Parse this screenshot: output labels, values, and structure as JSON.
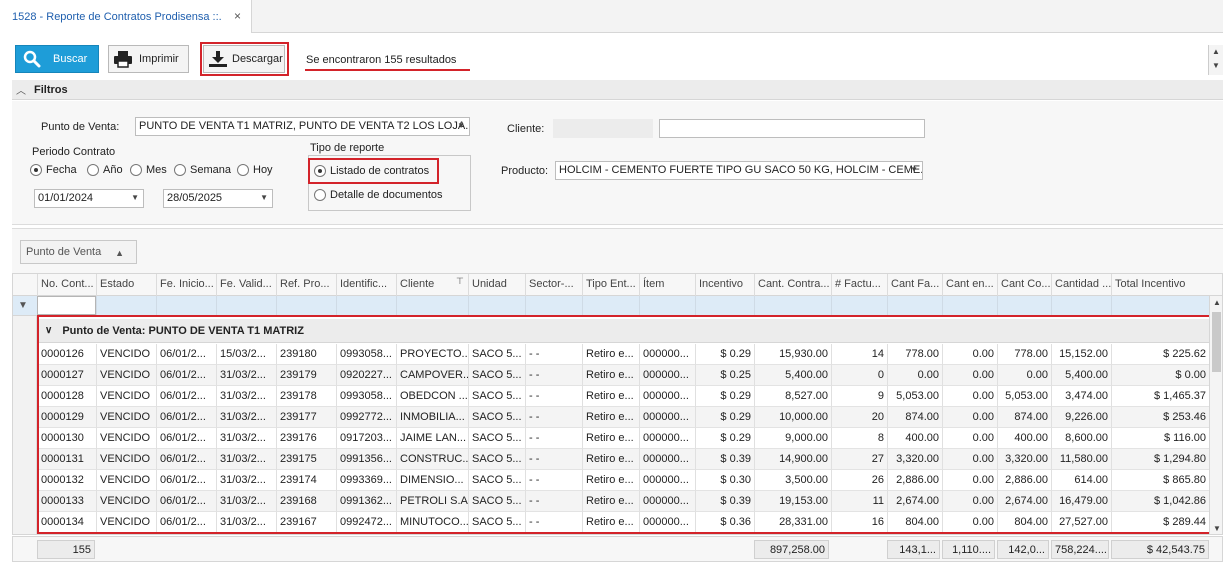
{
  "tab": {
    "title": "1528 - Reporte de Contratos Prodisensa ::.",
    "close": "×"
  },
  "toolbar": {
    "buscar": "Buscar",
    "imprimir": "Imprimir",
    "descargar": "Descargar",
    "results": "Se encontraron 155 resultados"
  },
  "filters": {
    "title": "Filtros",
    "punto_venta_label": "Punto de Venta:",
    "punto_venta_value": "PUNTO DE VENTA T1 MATRIZ, PUNTO DE VENTA T2  LOS LOJA...",
    "periodo_label": "Periodo Contrato",
    "periodo_options": [
      "Fecha",
      "Año",
      "Mes",
      "Semana",
      "Hoy"
    ],
    "periodo_selected": "Fecha",
    "fecha_desde": "01/01/2024",
    "fecha_hasta": "28/05/2025",
    "tipo_reporte_label": "Tipo de reporte",
    "tipo_reporte_options": [
      "Listado de contratos",
      "Detalle de documentos"
    ],
    "tipo_reporte_selected": "Listado de contratos",
    "cliente_label": "Cliente:",
    "producto_label": "Producto:",
    "producto_value": "HOLCIM  - CEMENTO FUERTE TIPO GU SACO 50 KG, HOLCIM  - CEME..."
  },
  "groupby": {
    "label": "Punto de Venta"
  },
  "grid": {
    "columns": [
      "No. Cont...",
      "Estado",
      "Fe. Inicio...",
      "Fe. Valid...",
      "Ref. Pro...",
      "Identific...",
      "Cliente",
      "Unidad",
      "Sector-...",
      "Tipo Ent...",
      "Ítem",
      "Incentivo",
      "Cant. Contra...",
      "# Factu...",
      "Cant Fa...",
      "Cant en...",
      "Cant Co...",
      "Cantidad ...",
      "Total Incentivo"
    ],
    "group_label": "Punto de Venta: PUNTO DE VENTA T1 MATRIZ",
    "rows": [
      [
        "0000126",
        "VENCIDO",
        "06/01/2...",
        "15/03/2...",
        "239180",
        "0993058...",
        "PROYECTO...",
        "SACO 5...",
        "- -",
        "Retiro e...",
        "000000...",
        "$ 0.29",
        "15,930.00",
        "14",
        "778.00",
        "0.00",
        "778.00",
        "15,152.00",
        "$ 225.62"
      ],
      [
        "0000127",
        "VENCIDO",
        "06/01/2...",
        "31/03/2...",
        "239179",
        "0920227...",
        "CAMPOVER...",
        "SACO 5...",
        "- -",
        "Retiro e...",
        "000000...",
        "$ 0.25",
        "5,400.00",
        "0",
        "0.00",
        "0.00",
        "0.00",
        "5,400.00",
        "$ 0.00"
      ],
      [
        "0000128",
        "VENCIDO",
        "06/01/2...",
        "31/03/2...",
        "239178",
        "0993058...",
        "OBEDCON ...",
        "SACO 5...",
        "- -",
        "Retiro e...",
        "000000...",
        "$ 0.29",
        "8,527.00",
        "9",
        "5,053.00",
        "0.00",
        "5,053.00",
        "3,474.00",
        "$ 1,465.37"
      ],
      [
        "0000129",
        "VENCIDO",
        "06/01/2...",
        "31/03/2...",
        "239177",
        "0992772...",
        "INMOBILIA...",
        "SACO 5...",
        "- -",
        "Retiro e...",
        "000000...",
        "$ 0.29",
        "10,000.00",
        "20",
        "874.00",
        "0.00",
        "874.00",
        "9,226.00",
        "$ 253.46"
      ],
      [
        "0000130",
        "VENCIDO",
        "06/01/2...",
        "31/03/2...",
        "239176",
        "0917203...",
        "JAIME LAN...",
        "SACO 5...",
        "- -",
        "Retiro e...",
        "000000...",
        "$ 0.29",
        "9,000.00",
        "8",
        "400.00",
        "0.00",
        "400.00",
        "8,600.00",
        "$ 116.00"
      ],
      [
        "0000131",
        "VENCIDO",
        "06/01/2...",
        "31/03/2...",
        "239175",
        "0991356...",
        "CONSTRUC...",
        "SACO 5...",
        "- -",
        "Retiro e...",
        "000000...",
        "$ 0.39",
        "14,900.00",
        "27",
        "3,320.00",
        "0.00",
        "3,320.00",
        "11,580.00",
        "$ 1,294.80"
      ],
      [
        "0000132",
        "VENCIDO",
        "06/01/2...",
        "31/03/2...",
        "239174",
        "0993369...",
        "DIMENSIO...",
        "SACO 5...",
        "- -",
        "Retiro e...",
        "000000...",
        "$ 0.30",
        "3,500.00",
        "26",
        "2,886.00",
        "0.00",
        "2,886.00",
        "614.00",
        "$ 865.80"
      ],
      [
        "0000133",
        "VENCIDO",
        "06/01/2...",
        "31/03/2...",
        "239168",
        "0991362...",
        "PETROLI S.A",
        "SACO 5...",
        "- -",
        "Retiro e...",
        "000000...",
        "$ 0.39",
        "19,153.00",
        "11",
        "2,674.00",
        "0.00",
        "2,674.00",
        "16,479.00",
        "$ 1,042.86"
      ],
      [
        "0000134",
        "VENCIDO",
        "06/01/2...",
        "31/03/2...",
        "239167",
        "0992472...",
        "MINUTOCO...",
        "SACO 5...",
        "- -",
        "Retiro e...",
        "000000...",
        "$ 0.36",
        "28,331.00",
        "16",
        "804.00",
        "0.00",
        "804.00",
        "27,527.00",
        "$ 289.44"
      ]
    ]
  },
  "footer": {
    "count": "155",
    "cant_contratada": "897,258.00",
    "cant_facturada": "143,1...",
    "cant_entregada": "1,110....",
    "cant_comprometida": "142,0...",
    "cantidad_pendiente": "758,224....",
    "total_incentivo": "$ 42,543.75"
  },
  "colors": {
    "accent": "#1e9dd8",
    "highlight": "#d3232a",
    "tab_text": "#1f5fae"
  }
}
